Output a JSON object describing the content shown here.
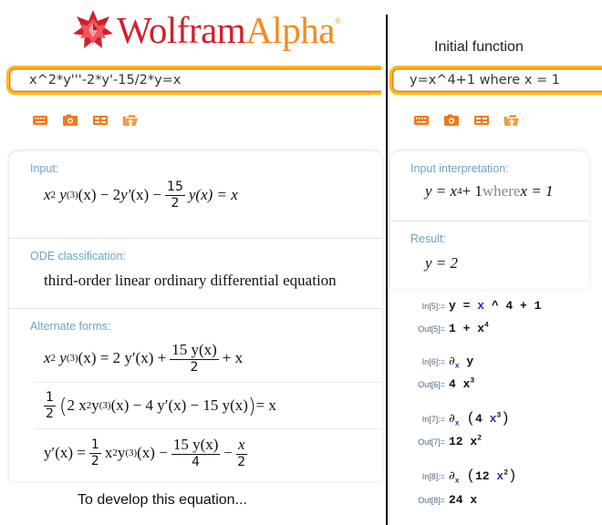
{
  "brand": {
    "name_part1": "Wolfram",
    "name_part2": "Alpha",
    "registered": "®",
    "colors": {
      "wolfram_red": "#d1202a",
      "alpha_orange": "#f58a1f",
      "input_border": "#fcbb1f"
    }
  },
  "left": {
    "query_value": "x^2*y'''-2*y'-15/2*y=x",
    "toolbar": [
      {
        "icon": "keyboard-icon",
        "label": "Extended keyboard"
      },
      {
        "icon": "camera-icon",
        "label": "Image input"
      },
      {
        "icon": "table-icon",
        "label": "Data input"
      },
      {
        "icon": "upload-folder-icon",
        "label": "File upload"
      }
    ],
    "pods": {
      "input": {
        "label": "Input:",
        "expr": {
          "t1": "x",
          "t1sup": "2",
          "t2": "y",
          "t2sup": "(3)",
          "t3": "(x) − 2 ",
          "t4": "y′",
          "t5": "(x) − ",
          "frac_num": "15",
          "frac_den": "2",
          "t6": "y(x) = x"
        }
      },
      "ode_classification": {
        "label": "ODE classification:",
        "value": "third-order linear ordinary differential equation"
      },
      "alternate_forms": {
        "label": "Alternate forms:",
        "forms": [
          {
            "lhs": "x",
            "lhs_sup": "2",
            "y": "y",
            "y_sup": "(3)",
            "mid": "(x) = 2 y′(x) + ",
            "frac_num": "15 y(x)",
            "frac_den": "2",
            "tail": " + x"
          },
          {
            "half_num": "1",
            "half_den": "2",
            "open": "(",
            "a": "2 x",
            "a_sup": "2",
            "b": " y",
            "b_sup": "(3)",
            "c": "(x) − 4 y′(x) − 15 y(x)",
            "close": ")",
            "tail": " = x"
          },
          {
            "lhs": "y′(x) = ",
            "half_num": "1",
            "half_den": "2",
            "a": " x",
            "a_sup": "2",
            "b": " y",
            "b_sup": "(3)",
            "c": "(x) − ",
            "frac_num": "15 y(x)",
            "frac_den": "4",
            "minus": " − ",
            "frac2_num": "x",
            "frac2_den": "2"
          }
        ]
      }
    },
    "caption": "To develop this equation..."
  },
  "right": {
    "title": "Initial function",
    "query_value": "y=x^4+1 where x = 1",
    "toolbar": [
      {
        "icon": "keyboard-icon",
        "label": "Extended keyboard"
      },
      {
        "icon": "camera-icon",
        "label": "Image input"
      },
      {
        "icon": "table-icon",
        "label": "Data input"
      },
      {
        "icon": "upload-folder-icon",
        "label": "File upload"
      }
    ],
    "pods": {
      "input_interpretation": {
        "label": "Input interpretation:",
        "expr": {
          "a": "y = x",
          "a_sup": "4",
          "b": " + 1 ",
          "where": "where",
          "c": " x = 1"
        }
      },
      "result": {
        "label": "Result:",
        "value": "y = 2"
      }
    },
    "notebook": [
      {
        "in_label": "In[5]:=",
        "in_parts": [
          "y",
          " = ",
          "x",
          " ^ 4 + 1"
        ],
        "out_label": "Out[5]=",
        "out": "1 + x",
        "out_sup": "4"
      },
      {
        "in_label": "In[6]:=",
        "in_op": "∂",
        "in_sub": "x",
        "in_arg": " y",
        "out_label": "Out[6]=",
        "out": "4 x",
        "out_sup": "3"
      },
      {
        "in_label": "In[7]:=",
        "in_op": "∂",
        "in_sub": "x",
        "in_arg_pre": "4 ",
        "in_arg_var": "x",
        "in_arg_sup": "3",
        "out_label": "Out[7]=",
        "out": "12 x",
        "out_sup": "2"
      },
      {
        "in_label": "In[8]:=",
        "in_op": "∂",
        "in_sub": "x",
        "in_arg_pre": "12 ",
        "in_arg_var": "x",
        "in_arg_sup": "2",
        "out_label": "Out[8]=",
        "out": "24 x"
      }
    ]
  }
}
